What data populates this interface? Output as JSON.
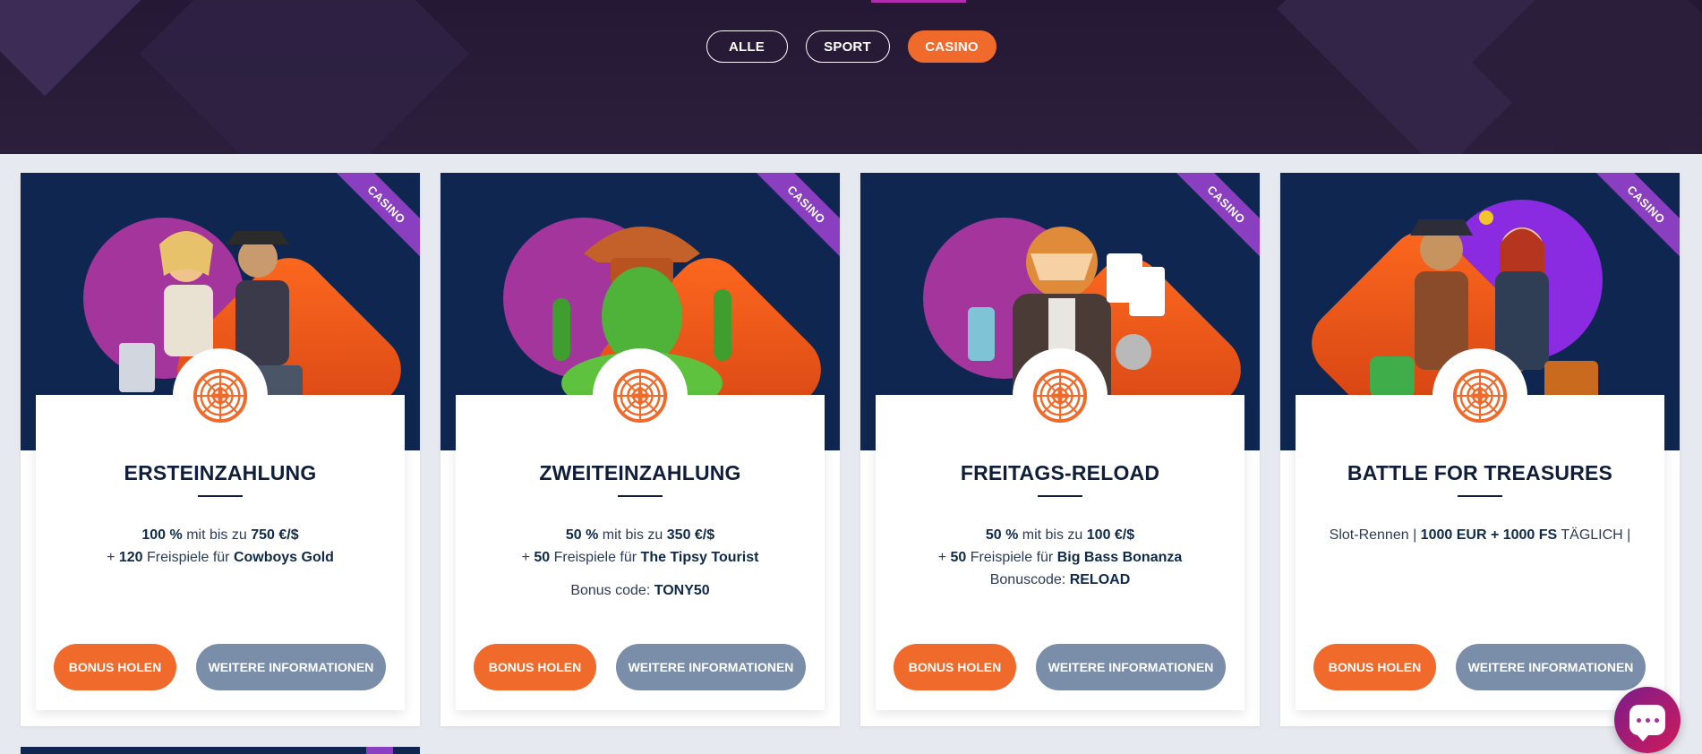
{
  "filters": {
    "all": "ALLE",
    "sport": "SPORT",
    "casino": "CASINO",
    "active": "CASINO"
  },
  "colors": {
    "accent_orange": "#ef6a2b",
    "info_button": "#7b8ea9",
    "card_media_bg": "#0f2750",
    "ribbon_purple": "#8a3ec0",
    "title_dark": "#0f1e3a"
  },
  "cards": [
    {
      "ribbon": "CASINO",
      "title": "ERSTEINZAHLUNG",
      "line1": {
        "a": "100 %",
        "b": " mit bis zu ",
        "c": "750 €/$"
      },
      "line2": {
        "a": "+ ",
        "b": "120",
        "c": " Freispiele für ",
        "d": "Cowboys Gold"
      },
      "bonus_button": "BONUS HOLEN",
      "info_button": "WEITERE INFORMATIONEN",
      "icon": "roulette-wheel-icon"
    },
    {
      "ribbon": "CASINO",
      "title": "ZWEITEINZAHLUNG",
      "line1": {
        "a": "50 %",
        "b": " mit bis zu ",
        "c": "350 €/$"
      },
      "line2": {
        "a": "+ ",
        "b": "50",
        "c": " Freispiele für ",
        "d": "The Tipsy Tourist"
      },
      "code": {
        "label": "Bonus code: ",
        "value": "TONY50"
      },
      "bonus_button": "BONUS HOLEN",
      "info_button": "WEITERE INFORMATIONEN",
      "icon": "roulette-wheel-icon"
    },
    {
      "ribbon": "CASINO",
      "title": "FREITAGS-RELOAD",
      "line1": {
        "a": "50 %",
        "b": " mit bis zu ",
        "c": "100 €/$"
      },
      "line2": {
        "a": "+ ",
        "b": "50",
        "c": " Freispiele für ",
        "d": "Big Bass Bonanza"
      },
      "line3": {
        "label": "Bonuscode: ",
        "value": "RELOAD"
      },
      "bonus_button": "BONUS HOLEN",
      "info_button": "WEITERE INFORMATIONEN",
      "icon": "roulette-wheel-icon"
    },
    {
      "ribbon": "CASINO",
      "title": "BATTLE FOR TREASURES",
      "line1": {
        "a": "Slot-Rennen | ",
        "b": "1000 EUR + 1000 FS",
        "c": " TÄGLICH |"
      },
      "bonus_button": "BONUS HOLEN",
      "info_button": "WEITERE INFORMATIONEN",
      "icon": "roulette-wheel-icon"
    }
  ],
  "chat": {
    "icon": "chat-bubble-icon"
  }
}
